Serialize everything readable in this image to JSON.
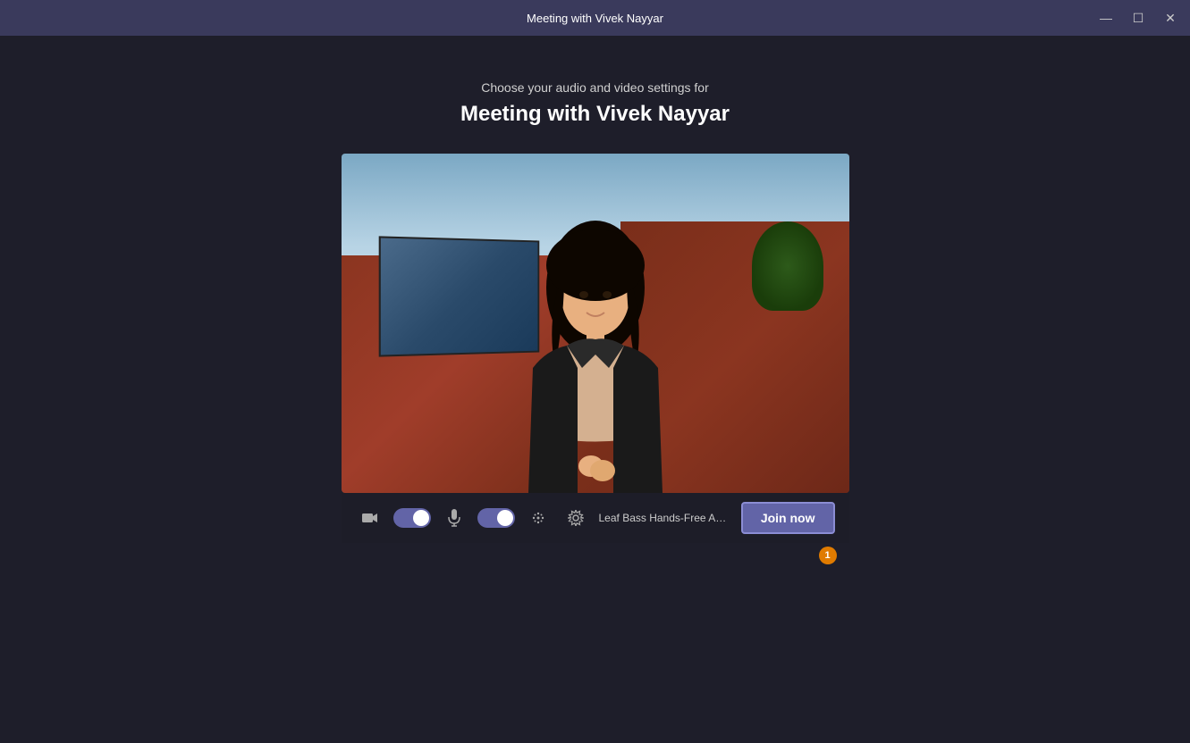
{
  "titlebar": {
    "title": "Meeting with Vivek Nayyar",
    "minimize_label": "minimize",
    "maximize_label": "maximize",
    "close_label": "close",
    "minimize_symbol": "—",
    "maximize_symbol": "☐",
    "close_symbol": "✕"
  },
  "header": {
    "subtitle": "Choose your audio and video settings for",
    "meeting_title": "Meeting with Vivek Nayyar"
  },
  "controls": {
    "camera_toggle_state": "on",
    "microphone_toggle_state": "on",
    "device_label": "Leaf Bass Hands-Free AG Au...",
    "join_button_label": "Join now",
    "notification_count": "1"
  }
}
